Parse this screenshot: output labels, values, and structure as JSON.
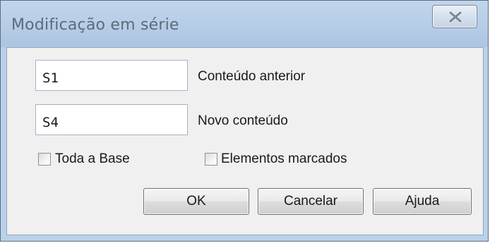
{
  "window": {
    "title": "Modificação em série",
    "close_icon": "close-icon"
  },
  "form": {
    "old_content": {
      "value": "S1",
      "label": "Conteúdo anterior"
    },
    "new_content": {
      "value": "S4",
      "label": "Novo conteúdo"
    }
  },
  "options": {
    "whole_base": {
      "label": "Toda a Base",
      "checked": false
    },
    "marked_elements": {
      "label": "Elementos marcados",
      "checked": false
    }
  },
  "buttons": {
    "ok": "OK",
    "cancel": "Cancelar",
    "help": "Ajuda"
  }
}
